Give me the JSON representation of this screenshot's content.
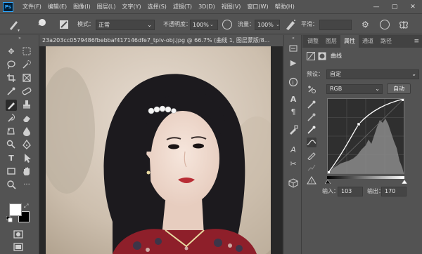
{
  "app": {
    "logo": "Ps",
    "menus": [
      "文件(F)",
      "编辑(E)",
      "图像(I)",
      "图层(L)",
      "文字(Y)",
      "选择(S)",
      "滤镜(T)",
      "3D(D)",
      "视图(V)",
      "窗口(W)",
      "帮助(H)"
    ],
    "window_controls": [
      "—",
      "▢",
      "✕"
    ]
  },
  "options": {
    "brush_size": "20",
    "mode_label": "模式：",
    "mode_value": "正常",
    "opacity_label": "不透明度：",
    "opacity_value": "100%",
    "flow_label": "流量：",
    "flow_value": "100%",
    "smooth_label": "平滑：",
    "smooth_value": ""
  },
  "document": {
    "tab_title": "23a203cc0579486fbebbaf417146dfe7_tplv-obj.jpg @ 66.7% (曲线 1, 图层蒙版/8...",
    "close": "×"
  },
  "panel": {
    "tabs": [
      "调整",
      "图层",
      "属性",
      "通道",
      "路径"
    ],
    "active_tab": "属性",
    "title": "曲线",
    "preset_label": "预设：",
    "preset_value": "自定",
    "channel_value": "RGB",
    "auto_button": "自动",
    "input_label": "输入：",
    "input_value": "103",
    "output_label": "输出：",
    "output_value": "170"
  },
  "colors": {
    "foreground": "#ffffff",
    "background": "#000000",
    "accent": "#31a8ff"
  }
}
